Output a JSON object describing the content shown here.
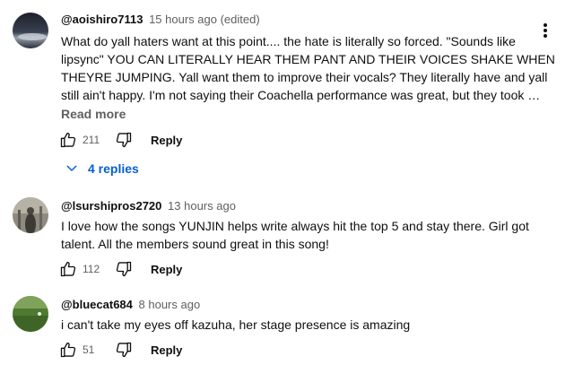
{
  "comments": [
    {
      "handle": "@aoishiro7113",
      "time": "15 hours ago (edited)",
      "lines": [
        "What do yall haters want at this point.... the hate is literally so forced. \"Sounds like",
        "lipsync\" YOU CAN LITERALLY HEAR THEM PANT AND THEIR VOICES SHAKE WHEN",
        "THEYRE JUMPING. Yall want them to improve their vocals? They literally have and yall",
        "still ain't happy. I'm not saying their Coachella performance was great, but they took …"
      ],
      "read_more": "Read more",
      "likes": "211",
      "reply_label": "Reply",
      "replies_label": "4 replies"
    },
    {
      "handle": "@lsurshipros2720",
      "time": "13 hours ago",
      "lines": [
        "I love how the songs  YUNJIN helps write always hit the top 5 and stay there.  Girl got",
        "talent.  All the members sound great in this song!"
      ],
      "likes": "112",
      "reply_label": "Reply"
    },
    {
      "handle": "@bluecat684",
      "time": "8 hours ago",
      "lines": [
        "i can't take my eyes off kazuha, her stage presence is amazing"
      ],
      "likes": "51",
      "reply_label": "Reply"
    }
  ],
  "icons": {
    "like": "thumbs-up-icon",
    "dislike": "thumbs-down-icon",
    "expand": "chevron-down-icon",
    "menu": "more-vert-icon"
  },
  "colors": {
    "text": "#0f0f0f",
    "secondary": "#606060",
    "link": "#065fd4"
  }
}
